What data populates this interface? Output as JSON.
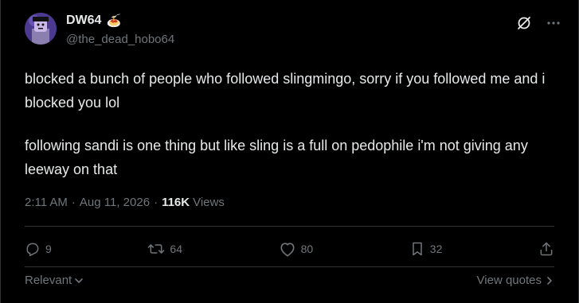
{
  "author": {
    "display_name": "DW64",
    "emoji": "🍝",
    "handle": "@the_dead_hobo64"
  },
  "tweet": {
    "paragraph_1": "blocked a bunch of people who followed slingmingo, sorry if you followed me and i blocked you lol",
    "paragraph_2": "following sandi is one thing but like sling is a full on pedophile i'm not giving any leeway on that",
    "time": "2:11 AM",
    "date": "Aug 11, 2026",
    "separator": "·",
    "views_count": "116K",
    "views_label": "Views"
  },
  "actions": {
    "replies": "9",
    "reposts": "64",
    "likes": "80",
    "bookmarks": "32"
  },
  "replies_bar": {
    "sort_label": "Relevant",
    "quotes_label": "View quotes"
  },
  "icons": {
    "top": [
      "grok-icon",
      "more-icon"
    ],
    "actions": [
      "reply-icon",
      "repost-icon",
      "like-icon",
      "bookmark-icon",
      "share-icon"
    ],
    "colors": {
      "background": "#000000",
      "text": "#e7e9ea",
      "muted": "#71767b",
      "border": "#2f3336"
    }
  }
}
